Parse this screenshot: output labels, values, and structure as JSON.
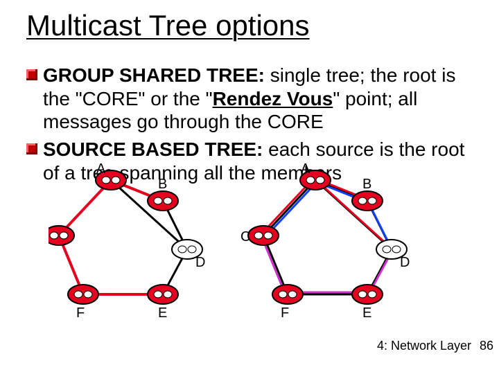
{
  "title": "Multicast Tree options",
  "bullets": [
    {
      "run1_bold": "GROUP SHARED TREE:",
      "run2": " single tree; the root is the \"CORE\" or the \"",
      "run3_bold_ul": "Rendez Vous",
      "run4": "\" point; all messages go through the CORE"
    },
    {
      "run1_bold": "SOURCE BASED TREE:",
      "run2": " each source is the root of a tree spanning all the members"
    }
  ],
  "diagram": {
    "nodes": [
      "A",
      "B",
      "C",
      "D",
      "E",
      "F"
    ],
    "active_nodes_left": [
      "A",
      "B",
      "C",
      "E",
      "F"
    ],
    "inactive_nodes_left": [
      "D"
    ],
    "active_nodes_right": [
      "A",
      "B",
      "C",
      "E",
      "F"
    ],
    "inactive_nodes_right": [
      "D"
    ],
    "type": "network-topology",
    "note": "Two hexagon-like topologies with router nodes; left shows one multicast tree (red edges), right shows multiple source-based trees (red/blue/magenta edges)"
  },
  "footer": "4: Network Layer",
  "page": "86",
  "colors": {
    "node_active": "#e6001f",
    "node_inactive": "#ffffff",
    "node_stroke": "#000000",
    "edge_default": "#000000",
    "edge_tree_red": "#e6001f",
    "edge_tree_blue": "#1040ff",
    "edge_tree_magenta": "#d030d0"
  }
}
